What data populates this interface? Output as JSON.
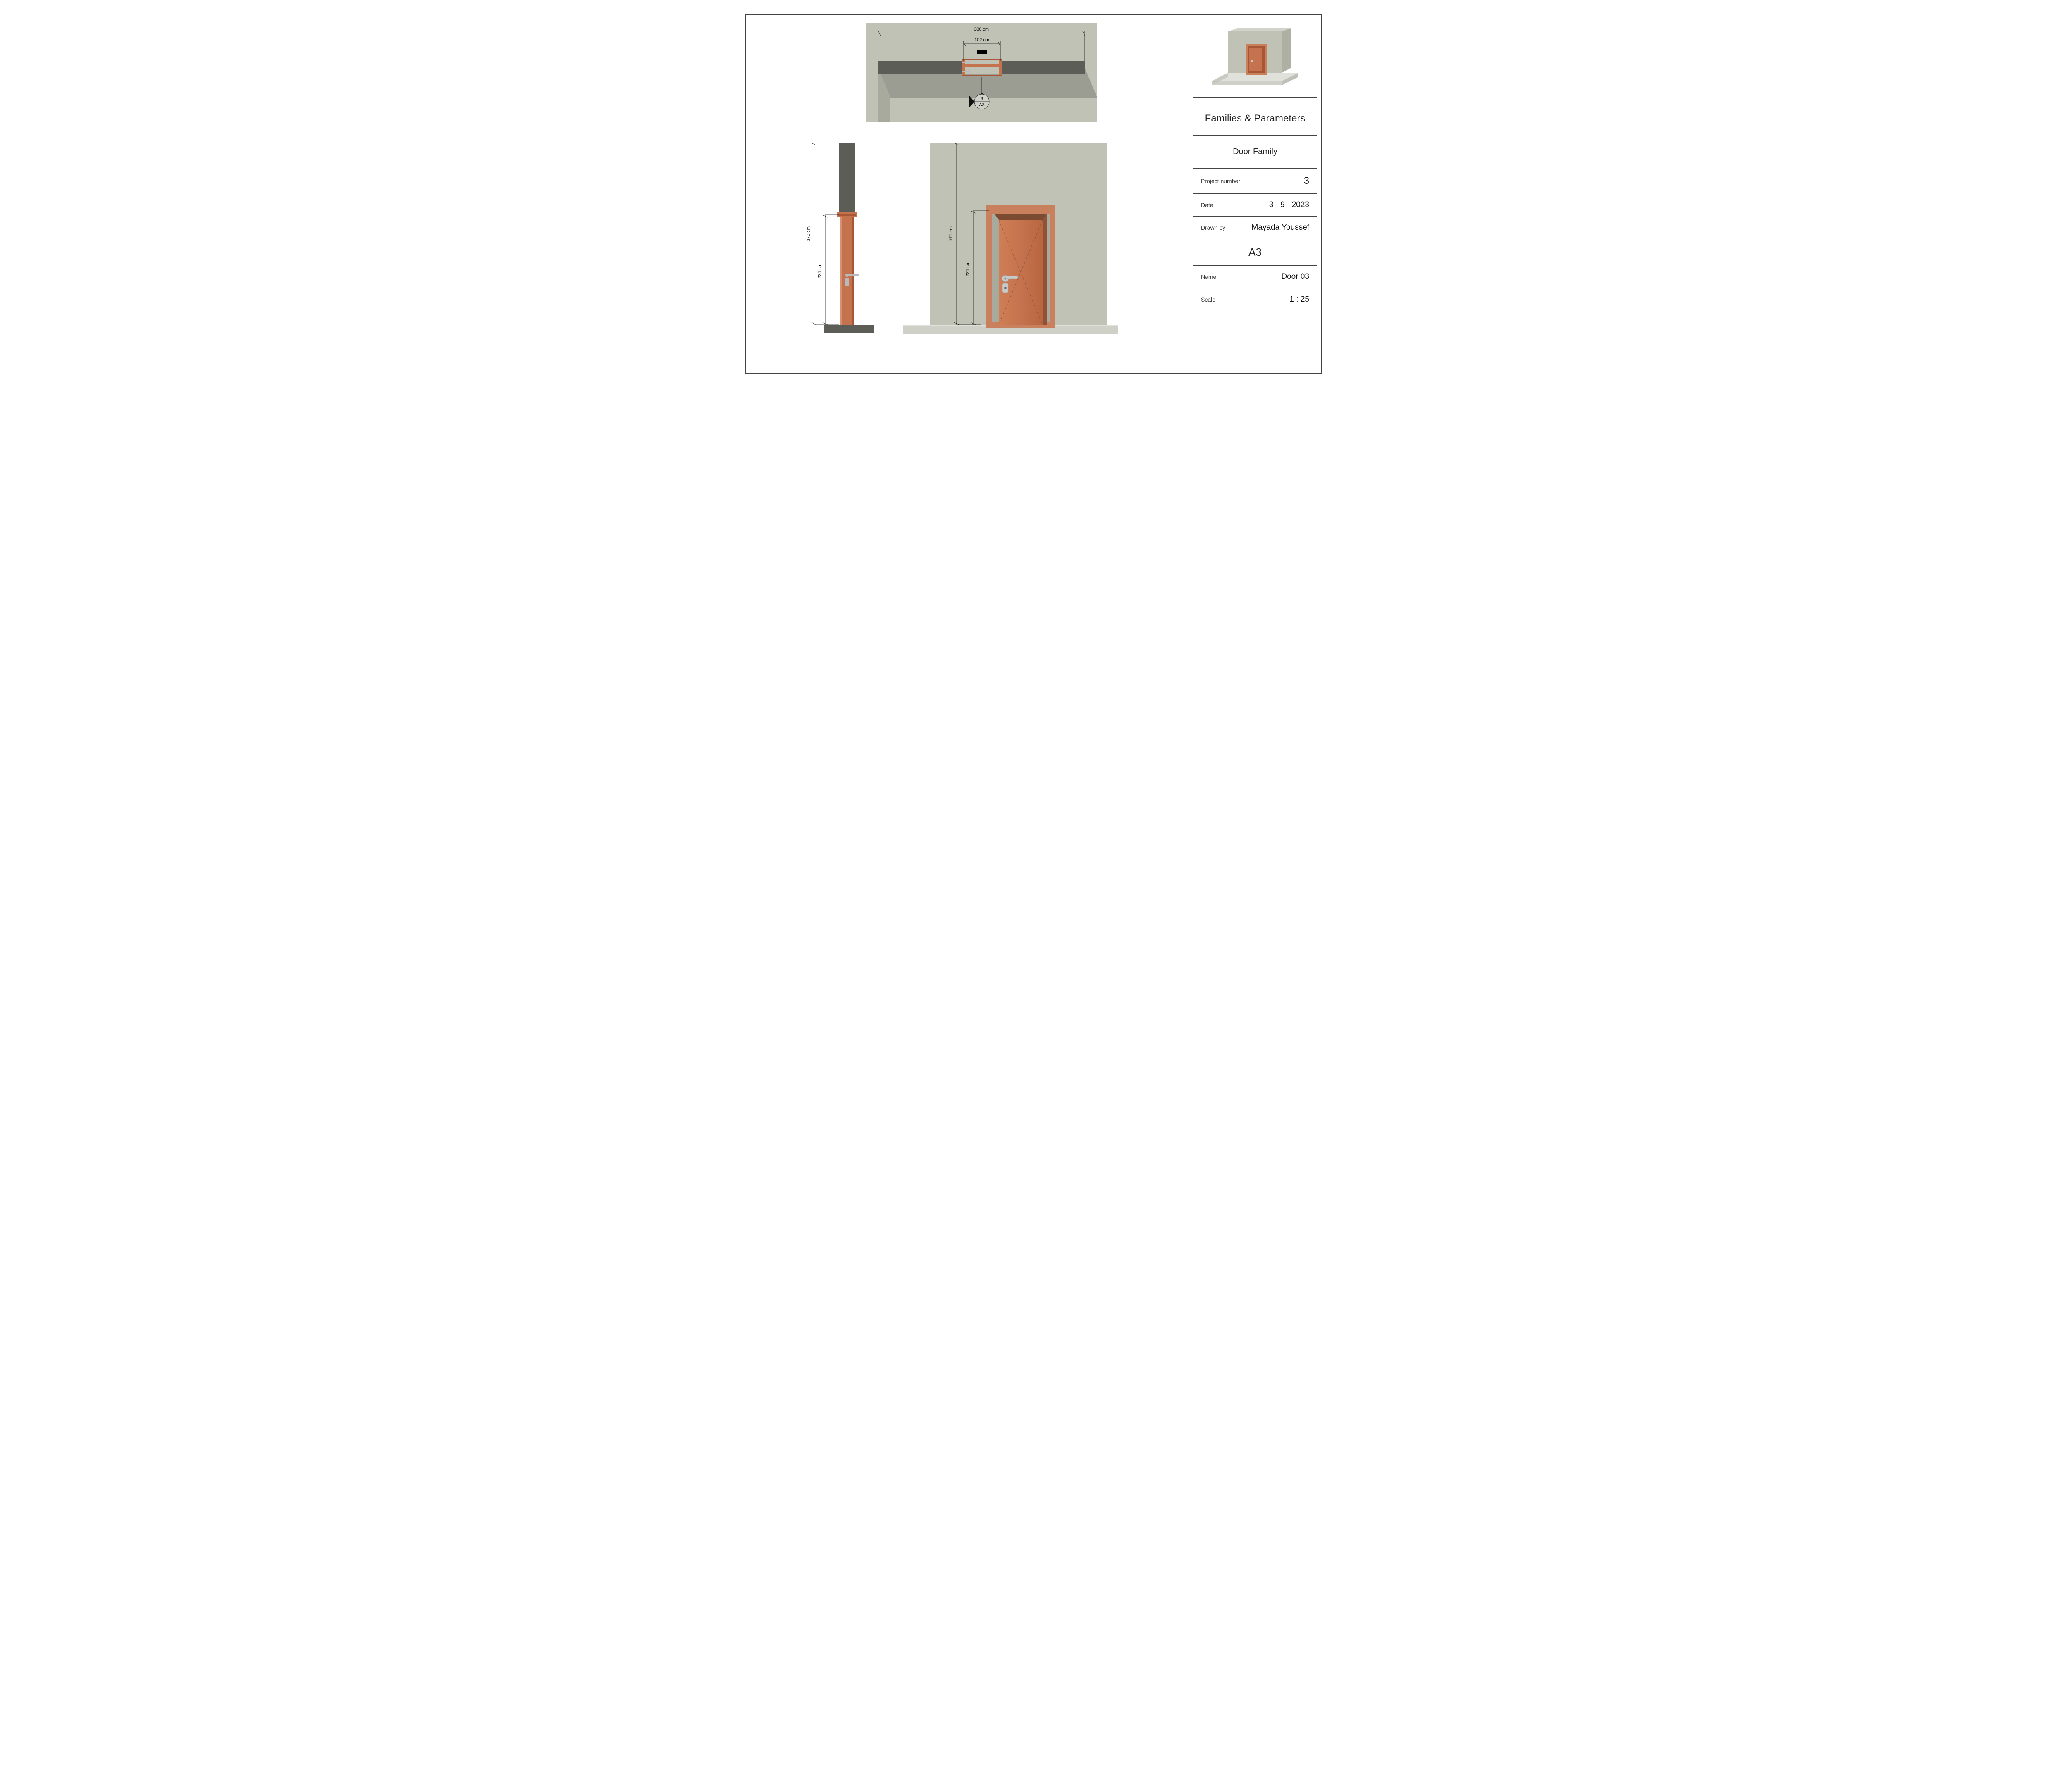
{
  "titleblock": {
    "heading": "Families & Parameters",
    "subheading": "Door Family",
    "project_number_label": "Project number",
    "project_number_value": "3",
    "date_label": "Date",
    "date_value": "3 - 9 - 2023",
    "drawn_by_label": "Drawn by",
    "drawn_by_value": "Mayada Youssef",
    "sheet_number": "A3",
    "name_label": "Name",
    "name_value": "Door 03",
    "scale_label": "Scale",
    "scale_value": "1 : 25"
  },
  "dimensions": {
    "plan_width": "380 cm",
    "door_width": "102 cm",
    "wall_height": "370 cm",
    "door_height": "225 cm"
  },
  "view_tag": {
    "detail_number": "3",
    "sheet_ref": "A3"
  },
  "colors": {
    "wall_light": "#c1c2b6",
    "wall_dark": "#5c5d56",
    "shadow": "#7c7d74",
    "door": "#c4734e",
    "door_dark": "#a75735",
    "door_frame": "#c9805d",
    "handle_metal": "#b9b9b9",
    "floor": "#cfd0c7"
  }
}
